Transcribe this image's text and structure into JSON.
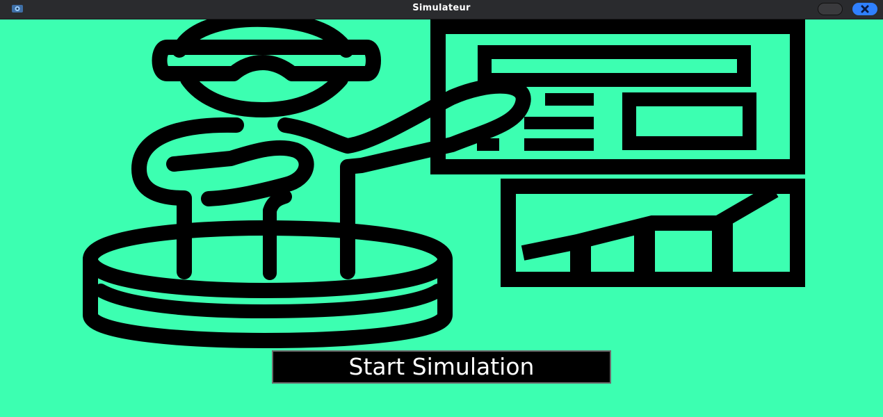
{
  "window": {
    "title": "Simulateur"
  },
  "main": {
    "start_button_label": "Start Simulation",
    "illustration_icon": "presenter-with-charts-icon"
  },
  "colors": {
    "background": "#3cffb1",
    "titlebar": "#2a2b2e",
    "close_button": "#2f80ff",
    "illustration": "#000000"
  }
}
